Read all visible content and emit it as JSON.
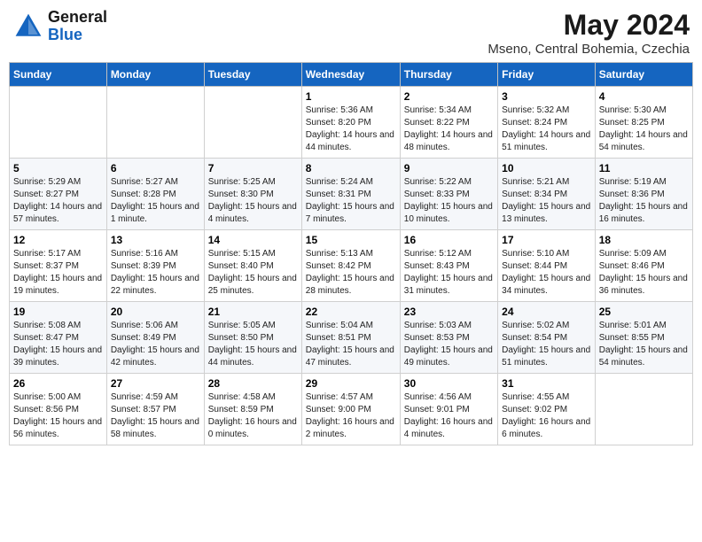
{
  "header": {
    "logo_line1": "General",
    "logo_line2": "Blue",
    "month": "May 2024",
    "location": "Mseno, Central Bohemia, Czechia"
  },
  "weekdays": [
    "Sunday",
    "Monday",
    "Tuesday",
    "Wednesday",
    "Thursday",
    "Friday",
    "Saturday"
  ],
  "weeks": [
    [
      {
        "day": "",
        "sunrise": "",
        "sunset": "",
        "daylight": ""
      },
      {
        "day": "",
        "sunrise": "",
        "sunset": "",
        "daylight": ""
      },
      {
        "day": "",
        "sunrise": "",
        "sunset": "",
        "daylight": ""
      },
      {
        "day": "1",
        "sunrise": "Sunrise: 5:36 AM",
        "sunset": "Sunset: 8:20 PM",
        "daylight": "Daylight: 14 hours and 44 minutes."
      },
      {
        "day": "2",
        "sunrise": "Sunrise: 5:34 AM",
        "sunset": "Sunset: 8:22 PM",
        "daylight": "Daylight: 14 hours and 48 minutes."
      },
      {
        "day": "3",
        "sunrise": "Sunrise: 5:32 AM",
        "sunset": "Sunset: 8:24 PM",
        "daylight": "Daylight: 14 hours and 51 minutes."
      },
      {
        "day": "4",
        "sunrise": "Sunrise: 5:30 AM",
        "sunset": "Sunset: 8:25 PM",
        "daylight": "Daylight: 14 hours and 54 minutes."
      }
    ],
    [
      {
        "day": "5",
        "sunrise": "Sunrise: 5:29 AM",
        "sunset": "Sunset: 8:27 PM",
        "daylight": "Daylight: 14 hours and 57 minutes."
      },
      {
        "day": "6",
        "sunrise": "Sunrise: 5:27 AM",
        "sunset": "Sunset: 8:28 PM",
        "daylight": "Daylight: 15 hours and 1 minute."
      },
      {
        "day": "7",
        "sunrise": "Sunrise: 5:25 AM",
        "sunset": "Sunset: 8:30 PM",
        "daylight": "Daylight: 15 hours and 4 minutes."
      },
      {
        "day": "8",
        "sunrise": "Sunrise: 5:24 AM",
        "sunset": "Sunset: 8:31 PM",
        "daylight": "Daylight: 15 hours and 7 minutes."
      },
      {
        "day": "9",
        "sunrise": "Sunrise: 5:22 AM",
        "sunset": "Sunset: 8:33 PM",
        "daylight": "Daylight: 15 hours and 10 minutes."
      },
      {
        "day": "10",
        "sunrise": "Sunrise: 5:21 AM",
        "sunset": "Sunset: 8:34 PM",
        "daylight": "Daylight: 15 hours and 13 minutes."
      },
      {
        "day": "11",
        "sunrise": "Sunrise: 5:19 AM",
        "sunset": "Sunset: 8:36 PM",
        "daylight": "Daylight: 15 hours and 16 minutes."
      }
    ],
    [
      {
        "day": "12",
        "sunrise": "Sunrise: 5:17 AM",
        "sunset": "Sunset: 8:37 PM",
        "daylight": "Daylight: 15 hours and 19 minutes."
      },
      {
        "day": "13",
        "sunrise": "Sunrise: 5:16 AM",
        "sunset": "Sunset: 8:39 PM",
        "daylight": "Daylight: 15 hours and 22 minutes."
      },
      {
        "day": "14",
        "sunrise": "Sunrise: 5:15 AM",
        "sunset": "Sunset: 8:40 PM",
        "daylight": "Daylight: 15 hours and 25 minutes."
      },
      {
        "day": "15",
        "sunrise": "Sunrise: 5:13 AM",
        "sunset": "Sunset: 8:42 PM",
        "daylight": "Daylight: 15 hours and 28 minutes."
      },
      {
        "day": "16",
        "sunrise": "Sunrise: 5:12 AM",
        "sunset": "Sunset: 8:43 PM",
        "daylight": "Daylight: 15 hours and 31 minutes."
      },
      {
        "day": "17",
        "sunrise": "Sunrise: 5:10 AM",
        "sunset": "Sunset: 8:44 PM",
        "daylight": "Daylight: 15 hours and 34 minutes."
      },
      {
        "day": "18",
        "sunrise": "Sunrise: 5:09 AM",
        "sunset": "Sunset: 8:46 PM",
        "daylight": "Daylight: 15 hours and 36 minutes."
      }
    ],
    [
      {
        "day": "19",
        "sunrise": "Sunrise: 5:08 AM",
        "sunset": "Sunset: 8:47 PM",
        "daylight": "Daylight: 15 hours and 39 minutes."
      },
      {
        "day": "20",
        "sunrise": "Sunrise: 5:06 AM",
        "sunset": "Sunset: 8:49 PM",
        "daylight": "Daylight: 15 hours and 42 minutes."
      },
      {
        "day": "21",
        "sunrise": "Sunrise: 5:05 AM",
        "sunset": "Sunset: 8:50 PM",
        "daylight": "Daylight: 15 hours and 44 minutes."
      },
      {
        "day": "22",
        "sunrise": "Sunrise: 5:04 AM",
        "sunset": "Sunset: 8:51 PM",
        "daylight": "Daylight: 15 hours and 47 minutes."
      },
      {
        "day": "23",
        "sunrise": "Sunrise: 5:03 AM",
        "sunset": "Sunset: 8:53 PM",
        "daylight": "Daylight: 15 hours and 49 minutes."
      },
      {
        "day": "24",
        "sunrise": "Sunrise: 5:02 AM",
        "sunset": "Sunset: 8:54 PM",
        "daylight": "Daylight: 15 hours and 51 minutes."
      },
      {
        "day": "25",
        "sunrise": "Sunrise: 5:01 AM",
        "sunset": "Sunset: 8:55 PM",
        "daylight": "Daylight: 15 hours and 54 minutes."
      }
    ],
    [
      {
        "day": "26",
        "sunrise": "Sunrise: 5:00 AM",
        "sunset": "Sunset: 8:56 PM",
        "daylight": "Daylight: 15 hours and 56 minutes."
      },
      {
        "day": "27",
        "sunrise": "Sunrise: 4:59 AM",
        "sunset": "Sunset: 8:57 PM",
        "daylight": "Daylight: 15 hours and 58 minutes."
      },
      {
        "day": "28",
        "sunrise": "Sunrise: 4:58 AM",
        "sunset": "Sunset: 8:59 PM",
        "daylight": "Daylight: 16 hours and 0 minutes."
      },
      {
        "day": "29",
        "sunrise": "Sunrise: 4:57 AM",
        "sunset": "Sunset: 9:00 PM",
        "daylight": "Daylight: 16 hours and 2 minutes."
      },
      {
        "day": "30",
        "sunrise": "Sunrise: 4:56 AM",
        "sunset": "Sunset: 9:01 PM",
        "daylight": "Daylight: 16 hours and 4 minutes."
      },
      {
        "day": "31",
        "sunrise": "Sunrise: 4:55 AM",
        "sunset": "Sunset: 9:02 PM",
        "daylight": "Daylight: 16 hours and 6 minutes."
      },
      {
        "day": "",
        "sunrise": "",
        "sunset": "",
        "daylight": ""
      }
    ]
  ]
}
